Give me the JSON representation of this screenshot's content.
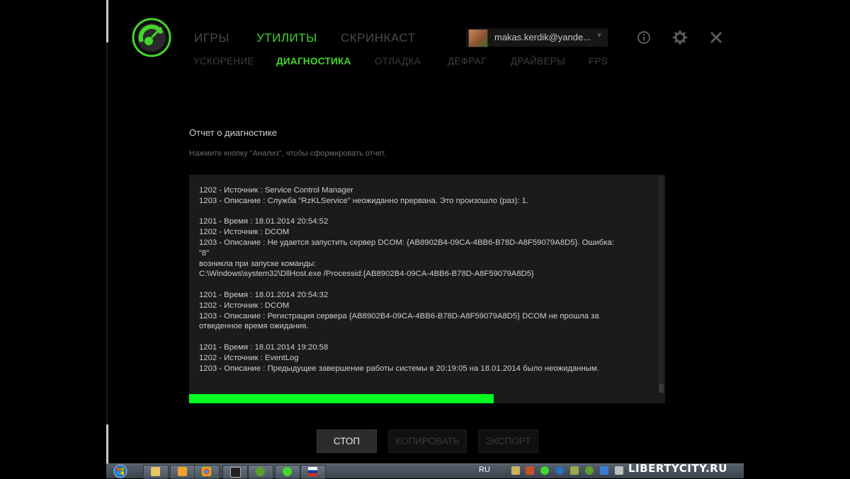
{
  "colors": {
    "accent": "#44d62c",
    "progress": "#00ff1e",
    "background": "#000000"
  },
  "nav": {
    "main": [
      {
        "label": "ИГРЫ",
        "active": false
      },
      {
        "label": "УТИЛИТЫ",
        "active": true
      },
      {
        "label": "СКРИНКАСТ",
        "active": false
      }
    ],
    "sub": [
      {
        "label": "УСКОРЕНИЕ",
        "active": false
      },
      {
        "label": "ДИАГНОСТИКА",
        "active": true
      },
      {
        "label": "ОТЛАДКА",
        "active": false
      },
      {
        "label": "ДЕФРАГ",
        "active": false
      },
      {
        "label": "ДРАЙВЕРЫ",
        "active": false
      },
      {
        "label": "FPS",
        "active": false
      }
    ]
  },
  "account": {
    "name": "makas.kerdik@yande...",
    "icons": [
      "avatar",
      "chevron-down-icon"
    ]
  },
  "toolbar_icons": [
    "info-icon",
    "gear-icon",
    "close-icon"
  ],
  "report": {
    "title": "Отчет о диагностике",
    "hint": "Нажмите кнопку \"Анализ\", чтобы сформировать отчет.",
    "lines": [
      "1202 - Источник : Service Control Manager",
      "1203 - Описание : Служба \"RzKLService\" неожиданно прервана. Это произошло (раз): 1.",
      "",
      "1201 - Время : 18.01.2014 20:54:52",
      "1202 - Источник : DCOM",
      "1203 - Описание : Не удается запустить сервер DCOM: {AB8902B4-09CA-4BB6-B78D-A8F59079A8D5}. Ошибка:",
      "\"8\"",
      "возникла при запуске команды:",
      "C:\\Windows\\system32\\DllHost.exe /Processid:{AB8902B4-09CA-4BB6-B78D-A8F59079A8D5}",
      "",
      "1201 - Время : 18.01.2014 20:54:32",
      "1202 - Источник : DCOM",
      "1203 - Описание : Регистрация сервера {AB8902B4-09CA-4BB6-B78D-A8F59079A8D5} DCOM не прошла за",
      "отведенное время ожидания.",
      "",
      "1201 - Время : 18.01.2014 19:20:58",
      "1202 - Источник : EventLog",
      "1203 - Описание : Предыдущее завершение работы системы в 20:19:05 на 18.01.2014 было неожиданным."
    ],
    "progress_percent": 64
  },
  "buttons": {
    "stop": "СТОП",
    "copy": "КОПИРОВАТЬ",
    "export": "ЭКСПОРТ"
  },
  "taskbar": {
    "language": "RU",
    "watermark": "LIBERTYCITY.RU",
    "icons": [
      "start-orb-icon",
      "explorer-icon",
      "media-player-icon",
      "chrome-icon",
      "app-icon",
      "utorrent-icon",
      "game-booster-icon",
      "flag-icon"
    ]
  }
}
